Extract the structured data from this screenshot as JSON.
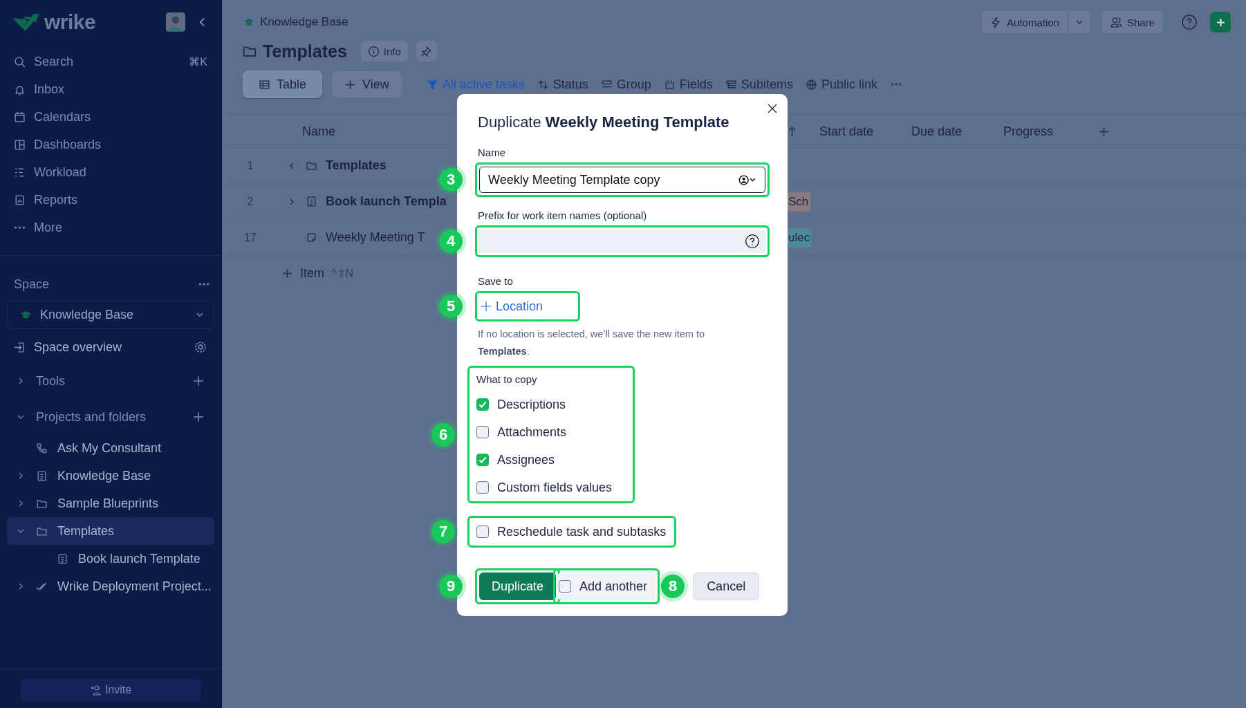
{
  "sidebar": {
    "logo": "wrike",
    "nav": [
      {
        "label": "Search",
        "shortcut": "⌘K"
      },
      {
        "label": "Inbox"
      },
      {
        "label": "Calendars"
      },
      {
        "label": "Dashboards"
      },
      {
        "label": "Workload"
      },
      {
        "label": "Reports"
      },
      {
        "label": "More"
      }
    ],
    "space_label": "Space",
    "space": "Knowledge Base",
    "overview": "Space overview",
    "sections": [
      {
        "label": "Tools",
        "expanded": false
      },
      {
        "label": "Projects and folders",
        "expanded": true,
        "children": [
          {
            "label": "Ask My Consultant",
            "kind": "contact",
            "selected": false
          },
          {
            "label": "Knowledge Base",
            "kind": "document",
            "expanded": false,
            "selected": false
          },
          {
            "label": "Sample Blueprints",
            "kind": "folder",
            "expanded": false,
            "selected": false
          },
          {
            "label": "Templates",
            "kind": "folder",
            "expanded": true,
            "selected": true,
            "children": [
              {
                "label": "Book launch Template",
                "kind": "document",
                "selected": false
              }
            ]
          },
          {
            "label": "Wrike Deployment Project...",
            "kind": "project",
            "expanded": false,
            "selected": false
          }
        ]
      }
    ],
    "invite": "Invite"
  },
  "header": {
    "breadcrumb": "Knowledge Base",
    "title": "Templates",
    "info": "Info",
    "automation": "Automation",
    "share": "Share"
  },
  "toolbar": {
    "views": [
      {
        "label": "Table",
        "selected": true
      }
    ],
    "add_view": "View",
    "filters": [
      {
        "label": "All active tasks",
        "active": true
      },
      {
        "label": "Status",
        "active": false
      },
      {
        "label": "Group",
        "active": false
      },
      {
        "label": "Fields",
        "active": false
      },
      {
        "label": "Subitems",
        "active": false
      },
      {
        "label": "Public link",
        "active": false
      }
    ]
  },
  "table": {
    "columns": [
      "Name",
      "Start date",
      "Due date",
      "Progress"
    ],
    "rows": [
      {
        "number": "1",
        "name": "Templates",
        "kind": "folder",
        "expanded": true,
        "bold": true
      },
      {
        "number": "2",
        "name": "Book launch Templa",
        "kind": "document",
        "expanded": false,
        "bold": true,
        "tag": {
          "text": "Sch",
          "color": "#8a7b80"
        }
      },
      {
        "number": "17",
        "name": "Weekly Meeting T",
        "kind": "note",
        "bold": false,
        "tag": {
          "text": "ulec",
          "color": "#4d8a98"
        }
      }
    ],
    "add_item": {
      "label": "Item",
      "shortcut": "^⇧N"
    }
  },
  "dialog": {
    "title": "Duplicate **Weekly Meeting Template**",
    "name_label": "Name",
    "name_value": "Weekly Meeting Template copy",
    "prefix_label": "Prefix for work item names (optional)",
    "save_to_label": "Save to",
    "location_button": "Location",
    "hint": "If no location is selected, we’ll save the new item to **Templates**.",
    "copy_label": "What to copy",
    "copy_options": [
      {
        "label": "Descriptions",
        "checked": true
      },
      {
        "label": "Attachments",
        "checked": false
      },
      {
        "label": "Assignees",
        "checked": true
      },
      {
        "label": "Custom fields values",
        "checked": false
      }
    ],
    "reschedule": {
      "label": "Reschedule task and subtasks",
      "checked": false
    },
    "duplicate": "Duplicate",
    "add_another": {
      "label": "Add another",
      "checked": false
    },
    "cancel": "Cancel",
    "markers": {
      "name": "3",
      "prefix": "4",
      "location": "5",
      "copy": "6",
      "reschedule": "7",
      "add_another": "8",
      "duplicate": "9"
    }
  }
}
